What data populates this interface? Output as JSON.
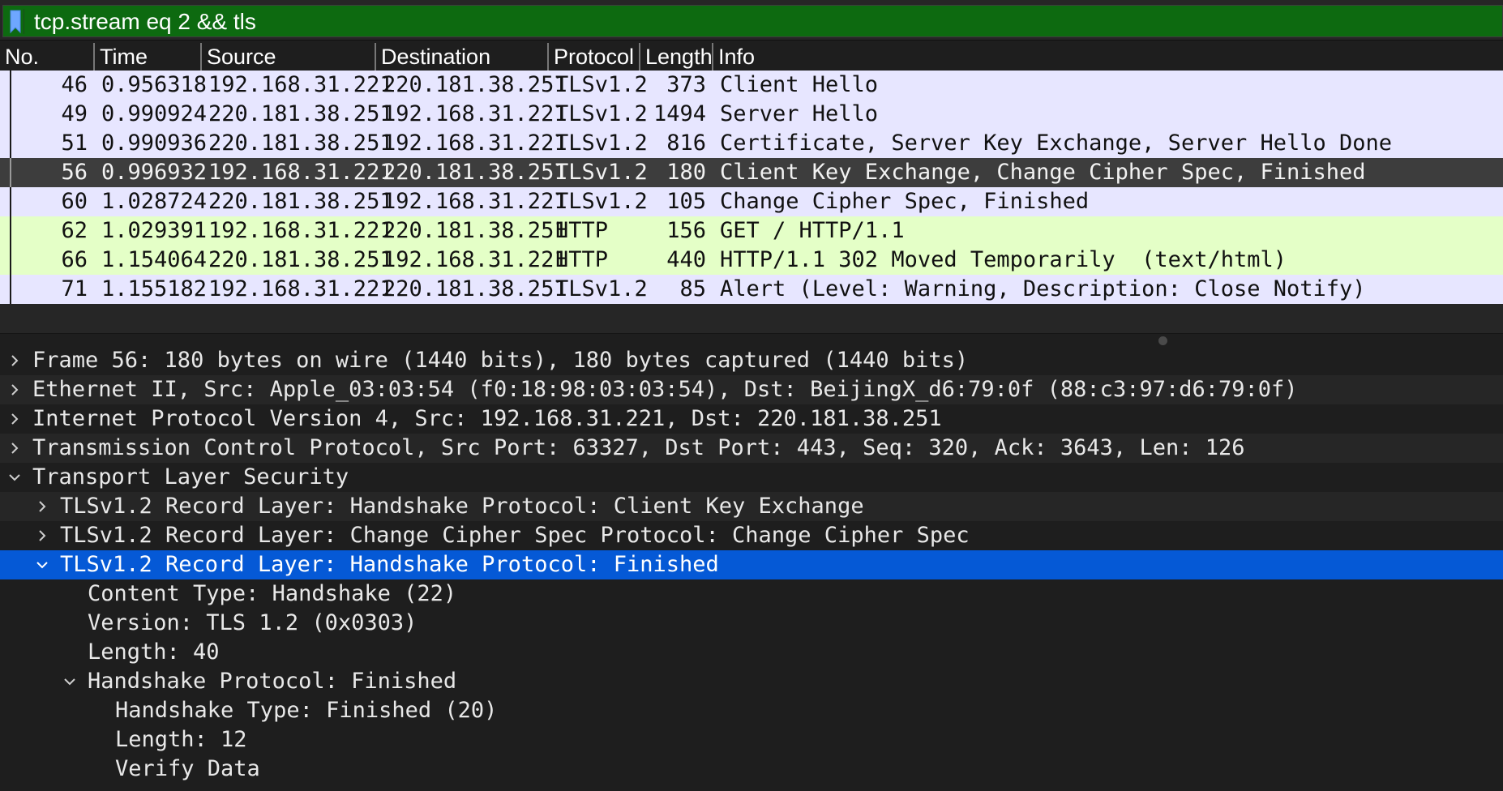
{
  "filter": {
    "text": "tcp.stream eq 2 && tls"
  },
  "columns": {
    "no": "No.",
    "time": "Time",
    "source": "Source",
    "destination": "Destination",
    "protocol": "Protocol",
    "length": "Length",
    "info": "Info"
  },
  "packets": [
    {
      "no": "46",
      "time": "0.956318",
      "source": "192.168.31.221",
      "destination": "220.181.38.251",
      "protocol": "TLSv1.2",
      "length": "373",
      "info": "Client Hello"
    },
    {
      "no": "49",
      "time": "0.990924",
      "source": "220.181.38.251",
      "destination": "192.168.31.221",
      "protocol": "TLSv1.2",
      "length": "1494",
      "info": "Server Hello"
    },
    {
      "no": "51",
      "time": "0.990936",
      "source": "220.181.38.251",
      "destination": "192.168.31.221",
      "protocol": "TLSv1.2",
      "length": "816",
      "info": "Certificate, Server Key Exchange, Server Hello Done"
    },
    {
      "no": "56",
      "time": "0.996932",
      "source": "192.168.31.221",
      "destination": "220.181.38.251",
      "protocol": "TLSv1.2",
      "length": "180",
      "info": "Client Key Exchange, Change Cipher Spec, Finished"
    },
    {
      "no": "60",
      "time": "1.028724",
      "source": "220.181.38.251",
      "destination": "192.168.31.221",
      "protocol": "TLSv1.2",
      "length": "105",
      "info": "Change Cipher Spec, Finished"
    },
    {
      "no": "62",
      "time": "1.029391",
      "source": "192.168.31.221",
      "destination": "220.181.38.251",
      "protocol": "HTTP",
      "length": "156",
      "info": "GET / HTTP/1.1"
    },
    {
      "no": "66",
      "time": "1.154064",
      "source": "220.181.38.251",
      "destination": "192.168.31.221",
      "protocol": "HTTP",
      "length": "440",
      "info": "HTTP/1.1 302 Moved Temporarily  (text/html)"
    },
    {
      "no": "71",
      "time": "1.155182",
      "source": "192.168.31.221",
      "destination": "220.181.38.251",
      "protocol": "TLSv1.2",
      "length": "85",
      "info": "Alert (Level: Warning, Description: Close Notify)"
    }
  ],
  "details": [
    {
      "text": "Frame 56: 180 bytes on wire (1440 bits), 180 bytes captured (1440 bits)",
      "level": 0,
      "expand": "collapsed"
    },
    {
      "text": "Ethernet II, Src: Apple_03:03:54 (f0:18:98:03:03:54), Dst: BeijingX_d6:79:0f (88:c3:97:d6:79:0f)",
      "level": 0,
      "expand": "collapsed"
    },
    {
      "text": "Internet Protocol Version 4, Src: 192.168.31.221, Dst: 220.181.38.251",
      "level": 0,
      "expand": "collapsed"
    },
    {
      "text": "Transmission Control Protocol, Src Port: 63327, Dst Port: 443, Seq: 320, Ack: 3643, Len: 126",
      "level": 0,
      "expand": "collapsed"
    },
    {
      "text": "Transport Layer Security",
      "level": 0,
      "expand": "expanded"
    },
    {
      "text": "TLSv1.2 Record Layer: Handshake Protocol: Client Key Exchange",
      "level": 1,
      "expand": "collapsed"
    },
    {
      "text": "TLSv1.2 Record Layer: Change Cipher Spec Protocol: Change Cipher Spec",
      "level": 1,
      "expand": "collapsed"
    },
    {
      "text": "TLSv1.2 Record Layer: Handshake Protocol: Finished",
      "level": 1,
      "expand": "expanded"
    },
    {
      "text": "Content Type: Handshake (22)",
      "level": 2,
      "expand": "none"
    },
    {
      "text": "Version: TLS 1.2 (0x0303)",
      "level": 2,
      "expand": "none"
    },
    {
      "text": "Length: 40",
      "level": 2,
      "expand": "none"
    },
    {
      "text": "Handshake Protocol: Finished",
      "level": 2,
      "expand": "expanded"
    },
    {
      "text": "Handshake Type: Finished (20)",
      "level": 3,
      "expand": "none"
    },
    {
      "text": "Length: 12",
      "level": 3,
      "expand": "none"
    },
    {
      "text": "Verify Data",
      "level": 3,
      "expand": "none"
    }
  ]
}
